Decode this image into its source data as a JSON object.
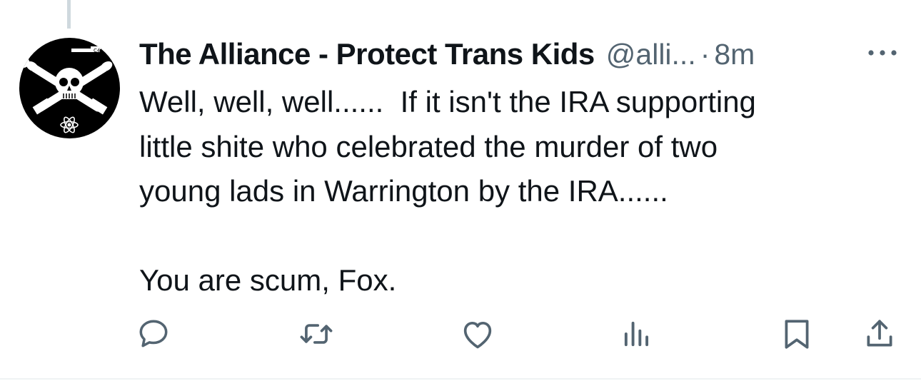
{
  "tweet": {
    "display_name": "The Alliance - Protect Trans Kids",
    "handle": "@alli...",
    "separator": "·",
    "time": "8m",
    "text": "Well, well, well......  If it isn't the IRA supporting\nlittle shite who celebrated the murder of two\nyoung lads in Warrington by the IRA......\n\nYou are scum, Fox."
  },
  "avatar": {
    "icon": "skull-crossbones-flag",
    "label": "C4"
  },
  "actions": [
    {
      "name": "reply",
      "icon": "reply-bubble-icon"
    },
    {
      "name": "repost",
      "icon": "repost-icon"
    },
    {
      "name": "like",
      "icon": "heart-icon"
    },
    {
      "name": "views",
      "icon": "analytics-bars-icon"
    },
    {
      "name": "bookmark",
      "icon": "bookmark-icon"
    },
    {
      "name": "share",
      "icon": "share-upload-icon"
    }
  ],
  "colors": {
    "text": "#0f1419",
    "secondary": "#536471",
    "divider": "#cfd9de"
  }
}
